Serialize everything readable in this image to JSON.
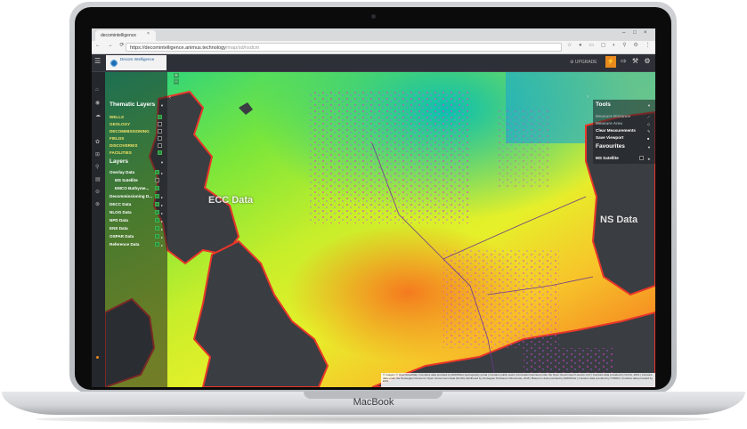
{
  "device": {
    "brand": "MacBook"
  },
  "browser": {
    "tab_title": "decomintelligence",
    "tab_close": "×",
    "window_buttons": [
      "–",
      "□",
      "×"
    ],
    "nav": "← → ⟳ ⌂",
    "url_host": "https://decomintelligence.animus.technology",
    "url_path": "/map/sd/nsdcm",
    "ext_icons": "☆ ● ▭ ▢ ◐ ⚲ ⚙ ⋮"
  },
  "app": {
    "logo_text": "Decom Intelligence",
    "upgrade_label": "⚙ UPGRADE",
    "upgrade_icon": "⚡",
    "header_icons": "⇨ ⚒ ⚙",
    "rail_icons": [
      "⌂",
      "◉",
      "☁",
      "✿",
      "⊞",
      "⚲",
      "▤",
      "⊖",
      "⊗"
    ]
  },
  "map": {
    "zoom_in": "+",
    "zoom_out": "−",
    "collapse_left": "‹",
    "collapse_right": "›",
    "labels": [
      "ECC Data",
      "NS Data"
    ],
    "attribution": "© Imagery © OpenStreetMap | Contains data provided by EMODNet Hydrography portal | Contains public sector information licensed under the Open Government Licence v3.0 | Contains data provided by NLOG, 2016 | Contains data under the Norwegian licence for Open Government data (NLOD) distributed by Norwegian Petroleum Directorate, 2016 | Based on data provided by EMODNet | Contains data provided by OSPAR | Contains data provided by ENS"
  },
  "left_panel": {
    "thematic_title": "Thematic Layers",
    "thematic_items": [
      "WELLS",
      "GEOLOGY",
      "DECOMMISSIONING",
      "FIELDS",
      "DISCOVERIES",
      "FACILITIES"
    ],
    "layers_title": "Layers",
    "layer_items": [
      {
        "label": "Overlay Data",
        "checked": true
      },
      {
        "label": "MS Satellite",
        "checked": false
      },
      {
        "label": "EMCO Bathyme...",
        "checked": true
      },
      {
        "label": "Decommissioning D...",
        "checked": true
      },
      {
        "label": "DECC Data",
        "checked": true
      },
      {
        "label": "NLOG Data",
        "checked": true
      },
      {
        "label": "NPD Data",
        "checked": true
      },
      {
        "label": "ENS Data",
        "checked": true
      },
      {
        "label": "OSPAR Data",
        "checked": true
      },
      {
        "label": "Reference Data",
        "checked": true
      }
    ]
  },
  "right_panel": {
    "tools_title": "Tools",
    "tools": [
      {
        "label": "Measure Distance",
        "dim": true
      },
      {
        "label": "Measure Area",
        "dim": true
      },
      {
        "label": "Clear Measurements",
        "dim": false
      },
      {
        "label": "Save Viewport",
        "dim": false
      }
    ],
    "favourites_title": "Favourites",
    "favourites": [
      "MS Satellite"
    ]
  },
  "colors": {
    "accent": "#e8891e",
    "panel_bg": "#1e2024",
    "land": "#3a3d42",
    "check_on": "#2e8b3e"
  }
}
